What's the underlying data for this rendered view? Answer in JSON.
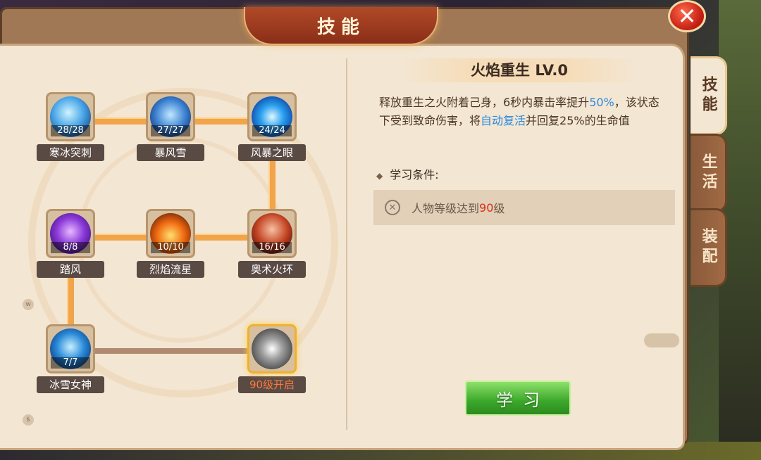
{
  "window": {
    "title": "技能",
    "close_symbol": "✕"
  },
  "tabs": [
    {
      "label": "技能",
      "active": true
    },
    {
      "label": "生活",
      "active": false
    },
    {
      "label": "装配",
      "active": false
    }
  ],
  "skills": [
    {
      "name": "寒冰突刺",
      "progress": "28/28",
      "icon": "ice-spike-icon"
    },
    {
      "name": "暴风雪",
      "progress": "27/27",
      "icon": "blizzard-icon"
    },
    {
      "name": "风暴之眼",
      "progress": "24/24",
      "icon": "storm-eye-icon"
    },
    {
      "name": "踏风",
      "progress": "8/8",
      "icon": "wind-step-icon"
    },
    {
      "name": "烈焰流星",
      "progress": "10/10",
      "icon": "flame-meteor-icon"
    },
    {
      "name": "奥术火环",
      "progress": "16/16",
      "icon": "arcane-fire-ring-icon"
    },
    {
      "name": "冰雪女神",
      "progress": "7/7",
      "icon": "ice-goddess-icon"
    },
    {
      "name": "90级开启",
      "progress": "",
      "icon": "locked-skill-icon"
    }
  ],
  "detail": {
    "title": "火焰重生 LV.0",
    "desc_part1": "释放重生之火附着己身，6秒内暴击率提升",
    "desc_hl1": "50%",
    "desc_part2": "，该状态下受到致命伤害，将",
    "desc_hl2": "自动复活",
    "desc_part3": "并回复25%的生命值",
    "cond_title": "学习条件:",
    "cond_part1": "人物等级达到",
    "cond_level": "90",
    "cond_part2": "级",
    "learn_label": "学习"
  },
  "colors": {
    "highlight": "#2a8ae0",
    "requirement": "#d8301a",
    "locked_label": "#ff7a3a",
    "connector_active": "#f2a44a"
  }
}
